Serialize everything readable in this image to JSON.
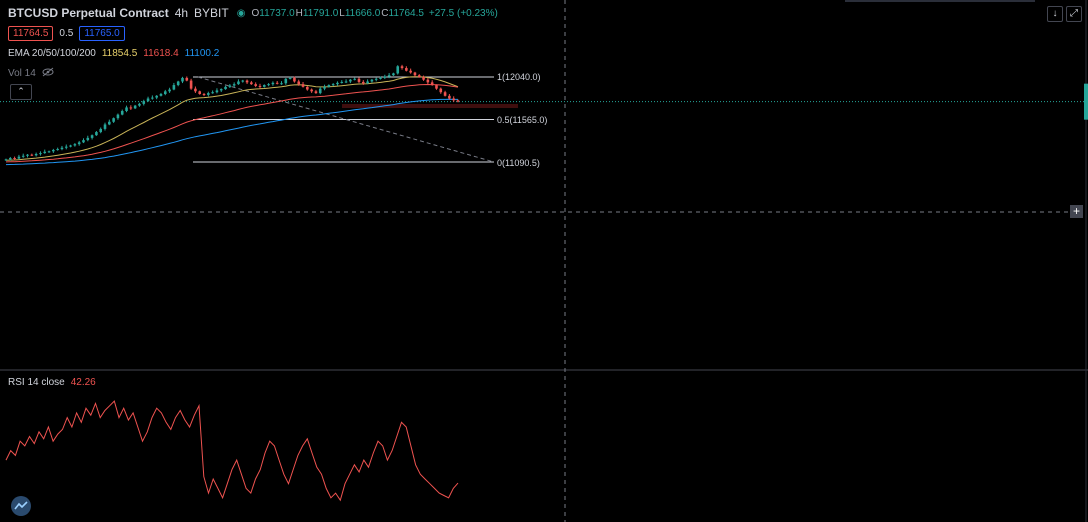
{
  "header": {
    "symbol": "BTCUSD Perpetual Contract",
    "interval": "4h",
    "exchange": "BYBIT",
    "ohlc": {
      "o_label": "O",
      "o": "11737.0",
      "h_label": "H",
      "h": "11791.0",
      "l_label": "L",
      "l": "11666.0",
      "c_label": "C",
      "c": "11764.5",
      "change": "+27.5 (+0.23%)"
    },
    "sell_price": "11764.5",
    "spread": "0.5",
    "buy_price": "11765.0"
  },
  "indicators": {
    "ema_label": "EMA 20/50/100/200",
    "ema_values": [
      "11854.5",
      "11618.4",
      "11100.2"
    ],
    "vol_label": "Vol 14"
  },
  "fib": {
    "levels": [
      {
        "ratio": 1,
        "price": 12040.0,
        "label": "1(12040.0)"
      },
      {
        "ratio": 0.5,
        "price": 11565.0,
        "label": "0.5(11565.0)"
      },
      {
        "ratio": 0,
        "price": 11090.5,
        "label": "0(11090.5)"
      }
    ]
  },
  "rsi": {
    "label": "RSI 14 close",
    "value": "42.26"
  },
  "colors": {
    "up": "#26a69a",
    "down": "#ef5350",
    "ema20": "#c9b458",
    "ema50": "#ef5350",
    "ema100": "#2196f3",
    "rsi": "#ef5350",
    "fib": "#d1d4dc",
    "background": "#000000"
  },
  "icons": {
    "down_arrow": "down-arrow-icon",
    "expand": "expand-icon",
    "eye_off": "eye-off-icon",
    "plus": "plus-icon",
    "chevron_up": "chevron-up-icon",
    "logo": "app-logo-icon"
  },
  "chart_data": {
    "type": "candlestick",
    "price_series_close": [
      11120,
      11135,
      11128,
      11150,
      11160,
      11172,
      11165,
      11180,
      11190,
      11205,
      11210,
      11225,
      11235,
      11250,
      11262,
      11275,
      11290,
      11310,
      11335,
      11360,
      11390,
      11425,
      11460,
      11510,
      11540,
      11580,
      11620,
      11660,
      11700,
      11690,
      11720,
      11740,
      11770,
      11800,
      11810,
      11830,
      11850,
      11880,
      11900,
      11950,
      11990,
      12030,
      12000,
      11910,
      11880,
      11850,
      11840,
      11860,
      11870,
      11890,
      11905,
      11930,
      11945,
      11960,
      11990,
      12000,
      11980,
      11960,
      11940,
      11930,
      11950,
      11960,
      11975,
      11965,
      11970,
      12020,
      12030,
      11990,
      11960,
      11930,
      11900,
      11880,
      11860,
      11910,
      11930,
      11950,
      11960,
      11975,
      11985,
      11990,
      12010,
      12020,
      11985,
      11970,
      11990,
      12010,
      12020,
      12030,
      12045,
      12060,
      12080,
      12160,
      12140,
      12110,
      12090,
      12060,
      12040,
      12010,
      11980,
      11950,
      11910,
      11870,
      11830,
      11800,
      11780,
      11764.5
    ],
    "rsi_values": [
      52,
      56,
      54,
      60,
      58,
      62,
      59,
      64,
      61,
      66,
      60,
      63,
      65,
      70,
      66,
      72,
      68,
      74,
      71,
      76,
      70,
      73,
      75,
      77,
      70,
      74,
      69,
      72,
      66,
      60,
      64,
      70,
      74,
      72,
      68,
      65,
      70,
      73,
      69,
      66,
      71,
      75,
      45,
      38,
      44,
      40,
      36,
      42,
      48,
      52,
      46,
      40,
      38,
      44,
      48,
      55,
      60,
      58,
      52,
      46,
      42,
      48,
      54,
      58,
      61,
      55,
      49,
      46,
      40,
      36,
      38,
      35,
      42,
      46,
      50,
      47,
      52,
      49,
      55,
      60,
      58,
      52,
      56,
      62,
      68,
      66,
      58,
      50,
      46,
      44,
      42,
      40,
      38,
      37,
      36,
      40,
      42.26
    ]
  }
}
